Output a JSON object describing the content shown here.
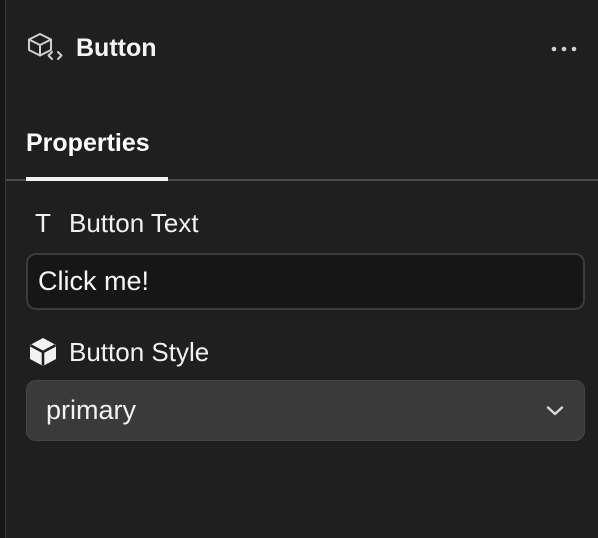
{
  "header": {
    "title": "Button",
    "component_icon": "component-code-icon",
    "more_icon": "more-horizontal-icon"
  },
  "tabs": [
    {
      "label": "Properties",
      "active": true
    }
  ],
  "fields": {
    "button_text": {
      "label": "Button Text",
      "icon": "text-type-icon",
      "icon_glyph": "T",
      "value": "Click me!"
    },
    "button_style": {
      "label": "Button Style",
      "icon": "cube-icon",
      "selected": "primary",
      "dropdown_icon": "chevron-down-icon"
    }
  },
  "colors": {
    "background": "#1f1f1f",
    "input_background": "#161616",
    "select_background": "#3a3a3a",
    "text": "#f2f2f2",
    "divider": "#4a4a4a"
  }
}
